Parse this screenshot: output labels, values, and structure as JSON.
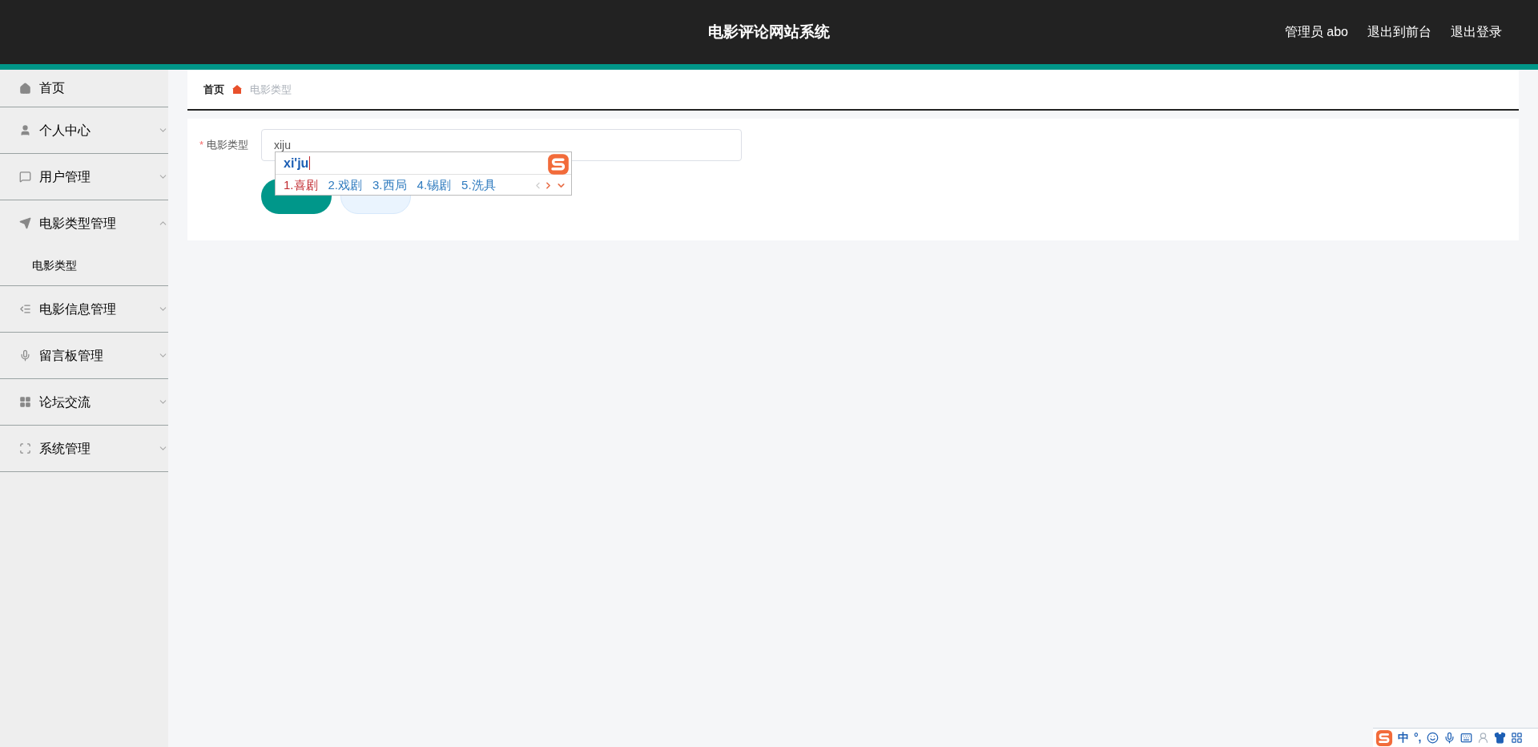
{
  "header": {
    "title": "电影评论网站系统",
    "links": [
      "管理员 abo",
      "退出到前台",
      "退出登录"
    ]
  },
  "sidebar": {
    "items": [
      {
        "label": "首页",
        "kind": "link"
      },
      {
        "label": "个人中心",
        "kind": "menu",
        "expanded": false
      },
      {
        "label": "用户管理",
        "kind": "menu",
        "expanded": false
      },
      {
        "label": "电影类型管理",
        "kind": "menu",
        "expanded": true,
        "children": [
          {
            "label": "电影类型",
            "selected": true
          }
        ]
      },
      {
        "label": "电影信息管理",
        "kind": "menu",
        "expanded": false
      },
      {
        "label": "留言板管理",
        "kind": "menu",
        "expanded": false
      },
      {
        "label": "论坛交流",
        "kind": "menu",
        "expanded": false
      },
      {
        "label": "系统管理",
        "kind": "menu",
        "expanded": false
      }
    ]
  },
  "breadcrumb": [
    "首页",
    "电影类型"
  ],
  "form": {
    "field": {
      "label": "电影类型",
      "required_mark": "*",
      "value": "xiju"
    },
    "buttons": [
      {
        "kind": "primary"
      },
      {
        "kind": "secondary"
      }
    ]
  },
  "ime": {
    "composition": "xi'ju",
    "candidates": [
      {
        "label": "1.喜剧",
        "selected": true
      },
      {
        "label": "2.戏剧",
        "selected": false
      },
      {
        "label": "3.西局",
        "selected": false
      },
      {
        "label": "4.锡剧",
        "selected": false
      },
      {
        "label": "5.洗具",
        "selected": false
      }
    ],
    "status_bar": {
      "mode": "中",
      "punctuation": "°,"
    }
  }
}
